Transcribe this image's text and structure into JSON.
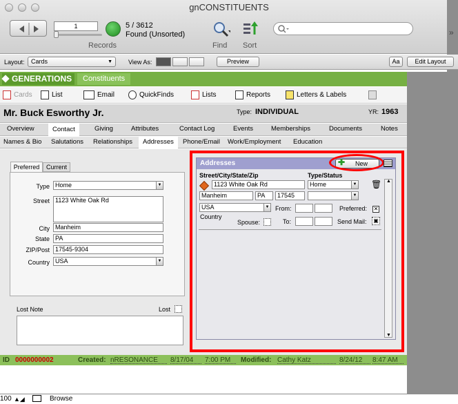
{
  "window": {
    "title": "gnCONSTITUENTS"
  },
  "toolbar": {
    "record_number": "1",
    "found_count": "5 / 3612",
    "found_status": "Found (Unsorted)",
    "records_label": "Records",
    "find_label": "Find",
    "sort_label": "Sort",
    "search_placeholder": ""
  },
  "layoutbar": {
    "layout_label": "Layout:",
    "layout_value": "Cards",
    "view_as_label": "View As:",
    "preview_label": "Preview",
    "aa_label": "Aa",
    "edit_layout_label": "Edit Layout"
  },
  "header": {
    "brand": "GENERATIONS",
    "module": "Constituents"
  },
  "iconbar": {
    "cards": "Cards",
    "list": "List",
    "email": "Email",
    "quickfinds": "QuickFinds",
    "lists": "Lists",
    "reports": "Reports",
    "letters": "Letters & Labels"
  },
  "record": {
    "name": "Mr. Buck Esworthy Jr.",
    "type_label": "Type:",
    "type_value": "INDIVIDUAL",
    "yr_label": "YR:",
    "yr_value": "1963"
  },
  "tabs_primary": [
    "Overview",
    "Contact",
    "Giving",
    "Attributes",
    "Contact Log",
    "Events",
    "Memberships",
    "Documents",
    "Notes"
  ],
  "tabs_secondary": [
    "Names & Bio",
    "Salutations",
    "Relationships",
    "Addresses",
    "Phone/Email",
    "Work/Employment",
    "Education"
  ],
  "left_panel": {
    "tab_preferred": "Preferred",
    "tab_current": "Current",
    "type_label": "Type",
    "type_value": "Home",
    "street_label": "Street",
    "street_value": "1123 White Oak Rd",
    "city_label": "City",
    "city_value": "Manheim",
    "state_label": "State",
    "state_value": "PA",
    "zip_label": "ZIP/Post",
    "zip_value": "17545-9304",
    "country_label": "Country",
    "country_value": "USA",
    "lost_note_label": "Lost Note",
    "lost_label": "Lost"
  },
  "addresses": {
    "title": "Addresses",
    "new_label": "New",
    "col_street": "Street/City/State/Zip",
    "col_type": "Type/Status",
    "street": "1123 White Oak Rd",
    "type": "Home",
    "city": "Manheim",
    "state": "PA",
    "zip": "17545",
    "status": "",
    "country": "USA",
    "country_label": "Country",
    "from_label": "From:",
    "to_label": "To:",
    "spouse_label": "Spouse:",
    "preferred_label": "Preferred:",
    "sendmail_label": "Send Mail:"
  },
  "statusbar": {
    "id_label": "ID",
    "id_value": "0000000002",
    "created_label": "Created:",
    "created_by": "nRESONANCE",
    "created_date": "8/17/04",
    "created_time": "7:00 PM",
    "modified_label": "Modified:",
    "modified_by": "Cathy Katz",
    "modified_date": "8/24/12",
    "modified_time": "8:47 AM"
  },
  "bottombar": {
    "zoom": "100",
    "mode": "Browse"
  },
  "colors": {
    "accent_green": "#76b043",
    "highlight_red": "#ff0000",
    "panel_header": "#9f9fcf",
    "id_red": "#cc0000"
  }
}
